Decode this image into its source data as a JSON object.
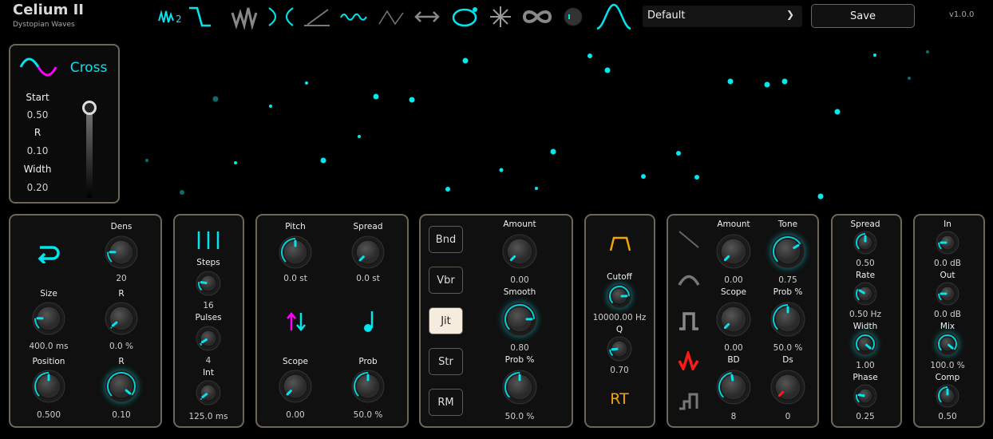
{
  "header": {
    "title": "Celium II",
    "subtitle": "Dystopian Waves",
    "preset": "Default",
    "save_label": "Save",
    "version": "v1.0.0",
    "mode_icons": [
      "wave-2-icon",
      "step-down-icon",
      "zigzag-icon",
      "cross-icon",
      "ramp-icon",
      "wobble-icon",
      "triangle-icon",
      "left-right-arrow-icon",
      "orbit-icon",
      "scatter-icon",
      "infinity-icon",
      "mini-knob-icon",
      "bell-curve-icon"
    ],
    "mode_icon_label": "2"
  },
  "display": {
    "mode": "Cross",
    "params": [
      {
        "label": "Start",
        "value": "0.50"
      },
      {
        "label": "R",
        "value": "0.10"
      },
      {
        "label": "Width",
        "value": "0.20"
      }
    ],
    "slider_value": 1.0
  },
  "colors": {
    "accent": "#00e5ee",
    "magenta": "#ff00ff",
    "orange": "#f5a400",
    "red": "#ff1a1a"
  },
  "grain": {
    "knobs": [
      {
        "label": "Dens",
        "value": "20",
        "fraction": 0.17
      },
      {
        "label": "Size",
        "value": "400.0 ms",
        "fraction": 0.17
      },
      {
        "label": "R",
        "value": "0.0 %",
        "fraction": 0.02
      },
      {
        "label": "Position",
        "value": "0.500",
        "fraction": 0.5
      },
      {
        "label": "R",
        "value": "0.10",
        "fraction": 0.98
      }
    ]
  },
  "rhythm": {
    "knobs": [
      {
        "label": "Steps",
        "value": "16",
        "fraction": 0.2
      },
      {
        "label": "Pulses",
        "value": "4",
        "fraction": 0.05
      },
      {
        "label": "Int",
        "value": "125.0 ms",
        "fraction": 0.03
      }
    ]
  },
  "pitch": {
    "knobs": [
      {
        "label": "Pitch",
        "value": "0.0 st",
        "fraction": 0.5
      },
      {
        "label": "Spread",
        "value": "0.0 st",
        "fraction": 0.0
      },
      {
        "label": "Scope",
        "value": "0.00",
        "fraction": 0.0
      },
      {
        "label": "Prob",
        "value": "50.0 %",
        "fraction": 0.5
      }
    ]
  },
  "mod": {
    "buttons": [
      {
        "label": "Bnd",
        "selected": false
      },
      {
        "label": "Vbr",
        "selected": false
      },
      {
        "label": "Jit",
        "selected": true
      },
      {
        "label": "Str",
        "selected": false
      },
      {
        "label": "RM",
        "selected": false
      }
    ],
    "knobs": [
      {
        "label": "Amount",
        "value": "0.00",
        "fraction": 0.0
      },
      {
        "label": "Smooth",
        "value": "0.80",
        "fraction": 0.83
      },
      {
        "label": "Prob %",
        "value": "50.0 %",
        "fraction": 0.5
      }
    ]
  },
  "filter": {
    "rt_label": "RT",
    "knobs": [
      {
        "label": "Cutoff",
        "value": "10000.00 Hz",
        "fraction": 0.83
      },
      {
        "label": "Q",
        "value": "0.70",
        "fraction": 0.15
      }
    ]
  },
  "dist": {
    "knobs": [
      {
        "label": "Amount",
        "value": "0.00",
        "fraction": 0.0
      },
      {
        "label": "Tone",
        "value": "0.75",
        "fraction": 0.72
      },
      {
        "label": "Scope",
        "value": "0.00",
        "fraction": 0.0
      },
      {
        "label": "Prob %",
        "value": "50.0 %",
        "fraction": 0.5
      },
      {
        "label": "BD",
        "value": "8",
        "fraction": 0.47
      },
      {
        "label": "Ds",
        "value": "0",
        "fraction": 0.0
      }
    ]
  },
  "stereo": {
    "knobs": [
      {
        "label": "Spread",
        "value": "0.50",
        "fraction": 0.5
      },
      {
        "label": "Rate",
        "value": "0.50 Hz",
        "fraction": 0.28
      },
      {
        "label": "Width",
        "value": "1.00",
        "fraction": 0.98
      },
      {
        "label": "Phase",
        "value": "0.25",
        "fraction": 0.2
      }
    ]
  },
  "output": {
    "knobs": [
      {
        "label": "In",
        "value": "0.0 dB",
        "fraction": 0.17
      },
      {
        "label": "Out",
        "value": "0.0 dB",
        "fraction": 0.17
      },
      {
        "label": "Mix",
        "value": "100.0 %",
        "fraction": 0.98
      },
      {
        "label": "Comp",
        "value": "0.50",
        "fraction": 0.5
      }
    ]
  }
}
